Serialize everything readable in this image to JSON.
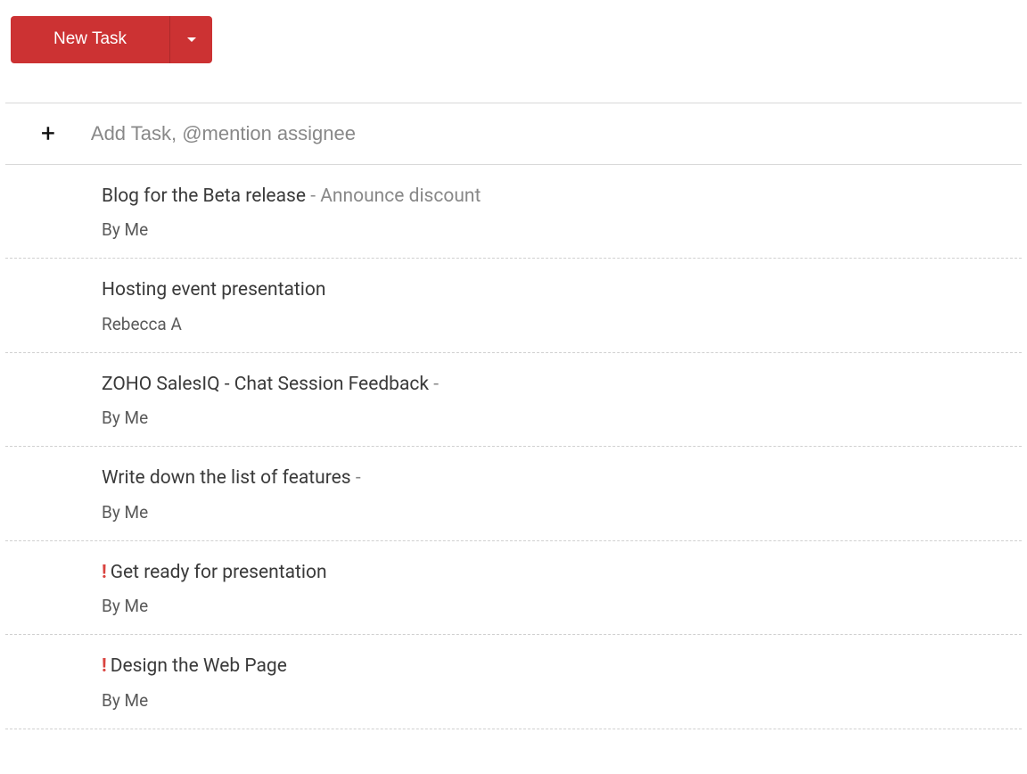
{
  "toolbar": {
    "new_task_label": "New Task"
  },
  "add_task": {
    "placeholder": "Add Task, @mention assignee"
  },
  "tasks": [
    {
      "title": "Blog for the Beta release",
      "subtitle": "Announce discount",
      "assignee": "By Me",
      "priority": false,
      "trailing_dash": false
    },
    {
      "title": "Hosting event presentation",
      "subtitle": "",
      "assignee": "Rebecca A",
      "priority": false,
      "trailing_dash": false
    },
    {
      "title": "ZOHO SalesIQ - Chat Session Feedback",
      "subtitle": "",
      "assignee": "By Me",
      "priority": false,
      "trailing_dash": true
    },
    {
      "title": "Write down the list of features",
      "subtitle": "",
      "assignee": "By Me",
      "priority": false,
      "trailing_dash": true
    },
    {
      "title": "Get ready for presentation",
      "subtitle": "",
      "assignee": "By Me",
      "priority": true,
      "trailing_dash": false
    },
    {
      "title": "Design the Web Page",
      "subtitle": "",
      "assignee": "By Me",
      "priority": true,
      "trailing_dash": false
    }
  ]
}
